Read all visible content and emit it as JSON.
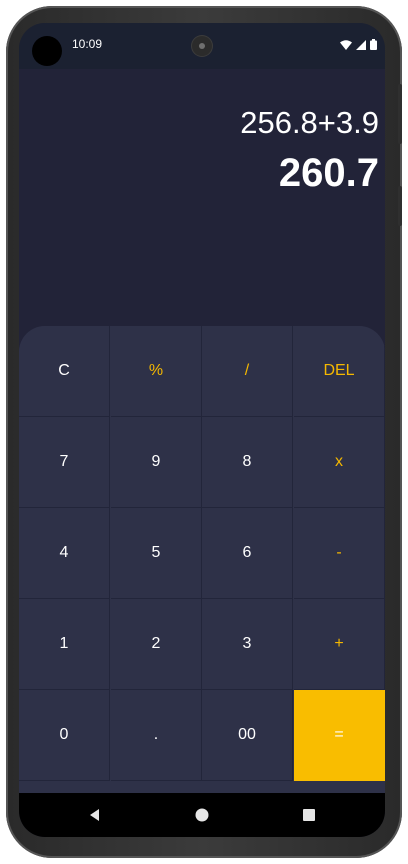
{
  "status_bar": {
    "time": "10:09",
    "icons": [
      "wifi-icon",
      "cell-signal-icon",
      "battery-icon"
    ]
  },
  "display": {
    "expression": "256.8+3.9",
    "result": "260.7"
  },
  "keypad": {
    "rows": [
      [
        {
          "label": "C",
          "kind": "function"
        },
        {
          "label": "%",
          "kind": "operator"
        },
        {
          "label": "/",
          "kind": "operator"
        },
        {
          "label": "DEL",
          "kind": "operator"
        }
      ],
      [
        {
          "label": "7",
          "kind": "digit"
        },
        {
          "label": "9",
          "kind": "digit"
        },
        {
          "label": "8",
          "kind": "digit"
        },
        {
          "label": "x",
          "kind": "operator"
        }
      ],
      [
        {
          "label": "4",
          "kind": "digit"
        },
        {
          "label": "5",
          "kind": "digit"
        },
        {
          "label": "6",
          "kind": "digit"
        },
        {
          "label": "-",
          "kind": "operator"
        }
      ],
      [
        {
          "label": "1",
          "kind": "digit"
        },
        {
          "label": "2",
          "kind": "digit"
        },
        {
          "label": "3",
          "kind": "digit"
        },
        {
          "label": "+",
          "kind": "operator"
        }
      ],
      [
        {
          "label": "0",
          "kind": "digit"
        },
        {
          "label": ".",
          "kind": "digit"
        },
        {
          "label": "00",
          "kind": "digit"
        },
        {
          "label": "=",
          "kind": "equals"
        }
      ]
    ]
  },
  "colors": {
    "background": "#222338",
    "keypad": "#2e3148",
    "accent": "#f5b800",
    "equals": "#f9bd00"
  },
  "nav": [
    "back-icon",
    "home-icon",
    "recents-icon"
  ]
}
